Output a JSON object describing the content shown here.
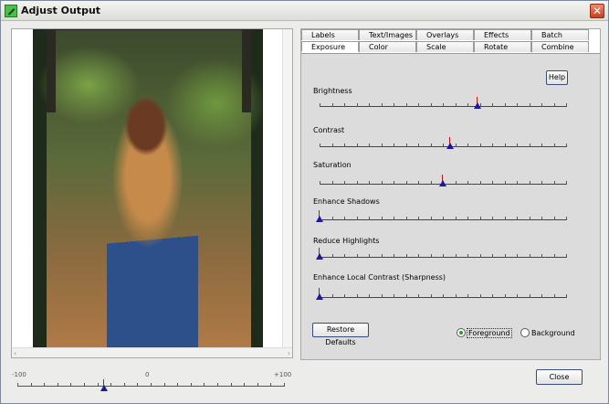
{
  "window": {
    "title": "Adjust Output",
    "close_glyph": "✕"
  },
  "tabs_row1": [
    "Labels",
    "Text/Images",
    "Overlays",
    "Effects",
    "Batch"
  ],
  "tabs_row2": [
    "Exposure",
    "Color",
    "Scale",
    "Rotate",
    "Combine"
  ],
  "active_tab": "Exposure",
  "help_label": "Help",
  "sliders": [
    {
      "label": "Brightness",
      "value": 0.64
    },
    {
      "label": "Contrast",
      "value": 0.53
    },
    {
      "label": "Saturation",
      "value": 0.5
    },
    {
      "label": "Enhance Shadows",
      "value": 0.0
    },
    {
      "label": "Reduce Highlights",
      "value": 0.0
    },
    {
      "label": "Enhance Local Contrast (Sharpness)",
      "value": 0.0
    }
  ],
  "restore_defaults_label": "Restore Defaults",
  "layer_radio": {
    "foreground": "Foreground",
    "background": "Background",
    "selected": "foreground"
  },
  "zoom": {
    "min_label": "-100",
    "mid_label": "0",
    "max_label": "+100",
    "value": -35
  },
  "close_button_label": "Close",
  "icons": [
    "app-icon",
    "close-icon",
    "scroll-left-icon",
    "scroll-right-icon"
  ],
  "colors": {
    "thumb_pin": "#d01010",
    "thumb_marker": "#1a1aa0",
    "radio_selected": "#2a9a2a"
  }
}
